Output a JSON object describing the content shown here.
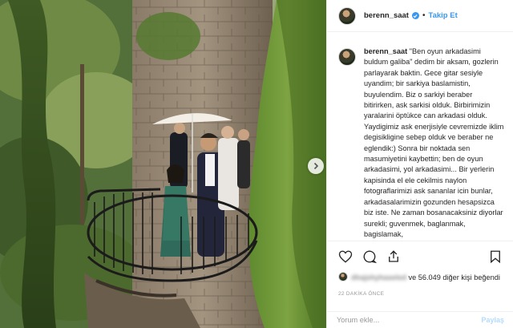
{
  "post": {
    "username": "berenn_saat",
    "follow_label": "Takip Et",
    "separator": "•",
    "caption": "\"Ben oyun arkadasimi buldum galiba\" dedim bir aksam, gozlerin parlayarak baktin. Gece gitar sesiyle uyandim; bir sarkiya baslamistin, buyulendim. Biz o sarkiyi beraber bitirirken, ask sarkisi olduk. Birbirimizin yaralarini öptükce can arkadasi olduk. Yaydigimiz ask enerjisiyle cevremizde iklim degisikligine sebep olduk ve beraber ne eglendik:) Sonra bir noktada sen masumiyetini kaybettin; ben de oyun arkadasimi, yol arkadasimi... Bir yerlerin kapisinda el ele cekilmis naylon fotograflarimizi ask sananlar icin bunlar, arkadasalarimizin gozunden hesapsizca biz iste. Ne zaman bosanacaksiniz diyorlar surekli; guvenmek, baglanmak, bagislamak,"
  },
  "likes": {
    "liker_blurred": "dhajshyhaseled",
    "text": "ve 56.049 diğer kişi beğendi"
  },
  "timestamp": "22 DAKİKA ÖNCE",
  "comment": {
    "placeholder": "Yorum ekle...",
    "post_label": "Paylaş"
  },
  "icons": {
    "like": "heart-icon",
    "comment": "comment-icon",
    "share": "share-icon",
    "save": "bookmark-icon",
    "verified": "verified-badge-icon",
    "next": "chevron-right-icon"
  },
  "colors": {
    "accent": "#3897f0",
    "text": "#262626",
    "muted": "#999999",
    "border": "#efefef"
  }
}
